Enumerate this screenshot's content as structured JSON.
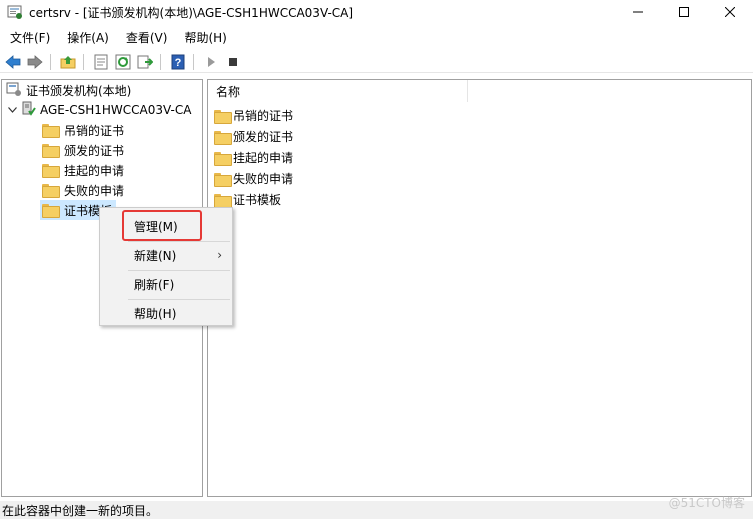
{
  "window": {
    "title": "certsrv - [证书颁发机构(本地)\\AGE-CSH1HWCCA03V-CA]",
    "minimize": "—",
    "maximize": "☐",
    "close": "✕"
  },
  "menubar": {
    "items": [
      {
        "label": "文件(F)"
      },
      {
        "label": "操作(A)"
      },
      {
        "label": "查看(V)"
      },
      {
        "label": "帮助(H)"
      }
    ]
  },
  "toolbar": {
    "buttons": [
      "back-arrow-icon",
      "forward-arrow-icon",
      "up-folder-icon",
      "properties-icon",
      "refresh-icon",
      "export-icon",
      "help-icon",
      "play-icon",
      "stop-icon"
    ]
  },
  "tree": {
    "root": "证书颁发机构(本地)",
    "ca": "AGE-CSH1HWCCA03V-CA",
    "expander": "⌄",
    "children": [
      {
        "label": "吊销的证书"
      },
      {
        "label": "颁发的证书"
      },
      {
        "label": "挂起的申请"
      },
      {
        "label": "失败的申请"
      },
      {
        "label": "证书模板"
      }
    ]
  },
  "list": {
    "column_header": "名称",
    "items": [
      {
        "label": "吊销的证书"
      },
      {
        "label": "颁发的证书"
      },
      {
        "label": "挂起的申请"
      },
      {
        "label": "失败的申请"
      },
      {
        "label": "证书模板"
      }
    ]
  },
  "context_menu": {
    "items": [
      {
        "label": "管理(M)"
      },
      {
        "label": "新建(N)",
        "submenu_arrow": "›"
      },
      {
        "label": "刷新(F)"
      },
      {
        "label": "帮助(H)"
      }
    ]
  },
  "status": {
    "text": "在此容器中创建一新的项目。"
  },
  "watermark": "@51CTO博客",
  "colors": {
    "selection": "#cce8ff",
    "highlight_border": "#e53935",
    "folder": "#f5cf63"
  }
}
